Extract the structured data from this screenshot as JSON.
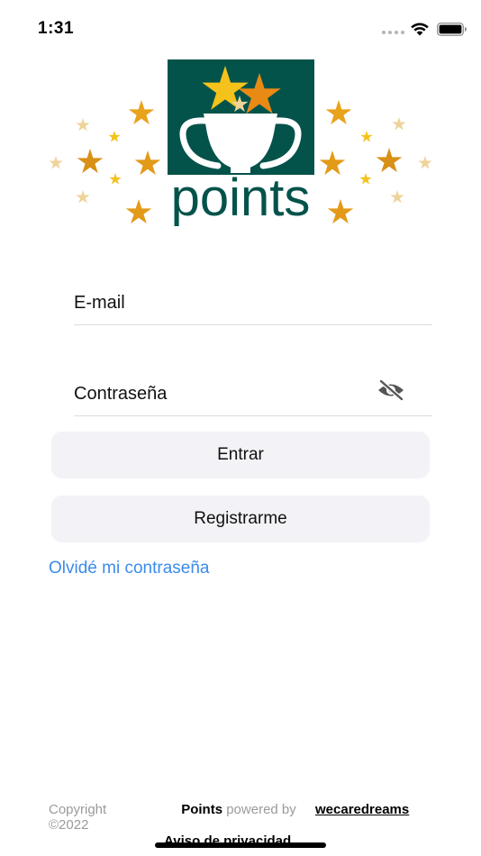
{
  "status_bar": {
    "time": "1:31"
  },
  "logo": {
    "wordmark": "points",
    "icon": "trophy-stars-icon",
    "colors": {
      "panel": "#04534b",
      "star_gold": "#f4b41a",
      "star_orange": "#e98a15",
      "star_pale": "#eed39a"
    }
  },
  "login_form": {
    "email_label": "E-mail",
    "password_label": "Contraseña",
    "password_toggle_icon": "eye-off-icon",
    "enter_button": "Entrar",
    "register_button": "Registrarme",
    "forgot_password_link": "Olvidé mi contraseña"
  },
  "footer": {
    "copyright": "Copyright ©2022",
    "brand": "Points",
    "powered_by": "powered by",
    "company": "wecaredreams",
    "privacy_link": "Aviso de privacidad"
  },
  "colors": {
    "link": "#3b8beb",
    "button_bg": "#f3f3f7",
    "brand_green": "#04534b"
  }
}
